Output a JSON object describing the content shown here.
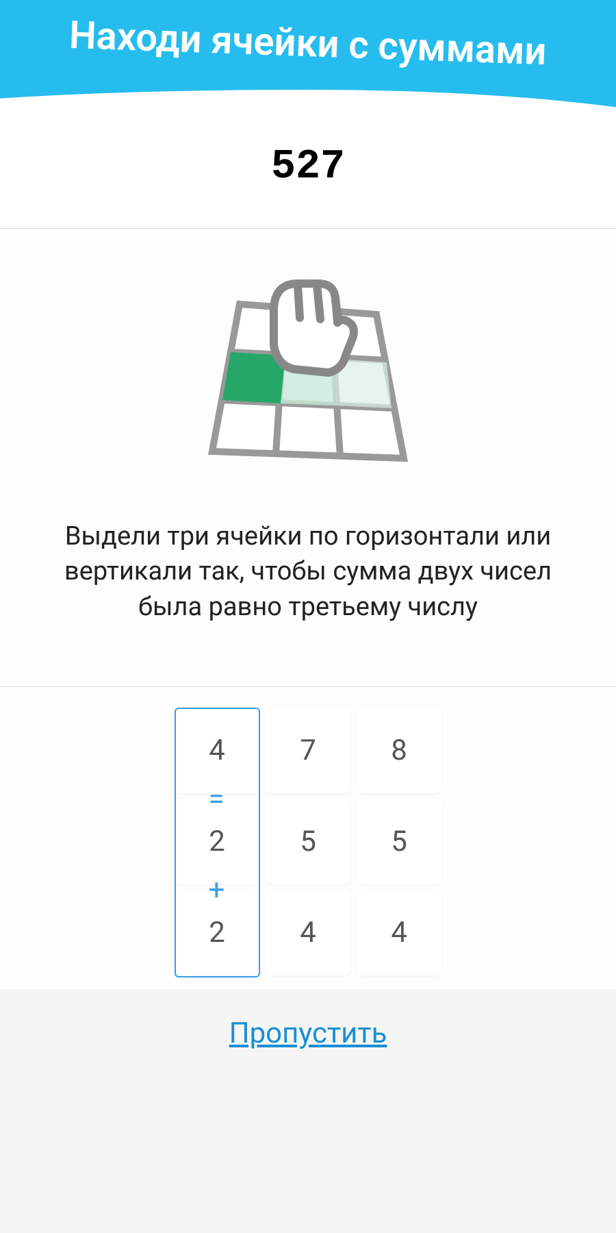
{
  "header": {
    "title": "Находи ячейки с суммами"
  },
  "score": "527",
  "instruction": "Выдели три ячейки по горизонтали или вертикали так, чтобы сумма двух чисел была равно третьему числу",
  "grid": {
    "cells": [
      "4",
      "7",
      "8",
      "2",
      "5",
      "5",
      "2",
      "4",
      "4"
    ],
    "operators": {
      "equals": "=",
      "plus": "+"
    }
  },
  "skip_label": "Пропустить"
}
